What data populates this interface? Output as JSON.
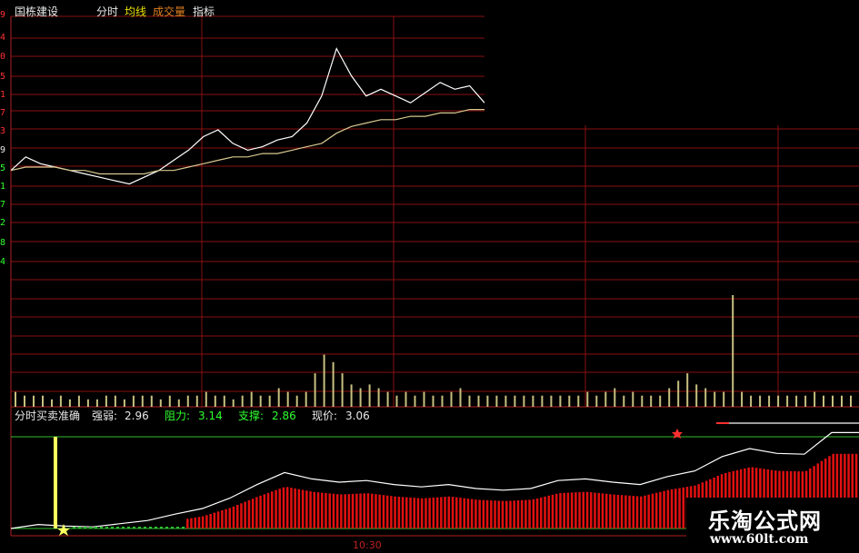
{
  "header": {
    "stock_name": "国栋建设",
    "menu": [
      {
        "label": "分时",
        "color": "#e8e8e8"
      },
      {
        "label": "均线",
        "color": "#e8e000"
      },
      {
        "label": "成交量",
        "color": "#e08020"
      },
      {
        "label": "指标",
        "color": "#e8e8e8"
      }
    ]
  },
  "y_axis_labels": [
    {
      "text": "9",
      "color": "#ff3030"
    },
    {
      "text": "4",
      "color": "#ff3030"
    },
    {
      "text": "0",
      "color": "#ff3030"
    },
    {
      "text": "5",
      "color": "#ff3030"
    },
    {
      "text": "1",
      "color": "#ff3030"
    },
    {
      "text": "7",
      "color": "#ff3030"
    },
    {
      "text": "3",
      "color": "#ff3030"
    },
    {
      "text": "9",
      "color": "#e8e8e8"
    },
    {
      "text": "5",
      "color": "#30ff30"
    },
    {
      "text": "1",
      "color": "#30ff30"
    },
    {
      "text": "7",
      "color": "#30ff30"
    },
    {
      "text": "2",
      "color": "#30ff30"
    },
    {
      "text": "8",
      "color": "#30ff30"
    },
    {
      "text": "4",
      "color": "#30ff30"
    }
  ],
  "indicator": {
    "name": "分时买卖准确",
    "strength_label": "强弱:",
    "strength_value": "2.96",
    "resistance_label": "阻力:",
    "resistance_value": "3.14",
    "support_label": "支撑:",
    "support_value": "2.86",
    "price_label": "现价:",
    "price_value": "3.06"
  },
  "x_axis": {
    "time_label": "10:30"
  },
  "watermark": {
    "title": "乐淘公式网",
    "url": "www.60lt.com"
  },
  "colors": {
    "grid": "#8a1010",
    "price_line": "#ffffff",
    "avg_line": "#d8c890",
    "volume_bar": "#c8c080",
    "indicator_bar": "#e01010",
    "support_line": "#30c030",
    "signal_bar": "#ffff60"
  },
  "chart_data": {
    "type": "line",
    "series": [
      {
        "name": "分时",
        "values": [
          3.0,
          3.04,
          3.02,
          3.01,
          3.0,
          2.99,
          2.98,
          2.97,
          2.96,
          2.98,
          3.0,
          3.03,
          3.06,
          3.1,
          3.12,
          3.08,
          3.06,
          3.07,
          3.09,
          3.1,
          3.14,
          3.22,
          3.36,
          3.28,
          3.22,
          3.24,
          3.22,
          3.2,
          3.23,
          3.26,
          3.24,
          3.25,
          3.2
        ]
      },
      {
        "name": "均线",
        "values": [
          3.0,
          3.01,
          3.01,
          3.01,
          3.0,
          3.0,
          2.99,
          2.99,
          2.99,
          2.99,
          3.0,
          3.0,
          3.01,
          3.02,
          3.03,
          3.04,
          3.04,
          3.05,
          3.05,
          3.06,
          3.07,
          3.08,
          3.11,
          3.13,
          3.14,
          3.15,
          3.15,
          3.16,
          3.16,
          3.17,
          3.17,
          3.18,
          3.18
        ]
      }
    ],
    "volume": [
      4,
      3,
      3,
      3,
      2,
      3,
      2,
      3,
      2,
      2,
      3,
      3,
      2,
      3,
      3,
      3,
      2,
      3,
      2,
      3,
      3,
      4,
      3,
      3,
      2,
      3,
      4,
      3,
      3,
      5,
      4,
      3,
      4,
      9,
      14,
      12,
      9,
      6,
      5,
      6,
      5,
      4,
      3,
      4,
      3,
      4,
      3,
      3,
      4,
      5,
      3,
      3,
      3,
      3,
      3,
      3,
      3,
      3,
      3,
      3,
      3,
      3,
      3,
      4,
      3,
      4,
      5,
      3,
      4,
      3,
      3,
      3,
      5,
      7,
      9,
      6,
      5,
      4,
      4,
      30,
      4,
      3,
      3,
      3,
      3,
      3,
      3,
      3,
      4,
      3,
      3,
      3,
      3
    ],
    "indicator_series": [
      {
        "name": "分时买卖准确",
        "values": [
          0.0,
          0.05,
          0.03,
          0.02,
          0.06,
          0.1,
          0.18,
          0.25,
          0.38,
          0.55,
          0.7,
          0.62,
          0.58,
          0.6,
          0.55,
          0.52,
          0.55,
          0.5,
          0.48,
          0.5,
          0.6,
          0.62,
          0.58,
          0.55,
          0.65,
          0.72,
          0.9,
          1.0,
          0.94,
          0.93,
          1.2,
          1.2
        ]
      }
    ]
  }
}
